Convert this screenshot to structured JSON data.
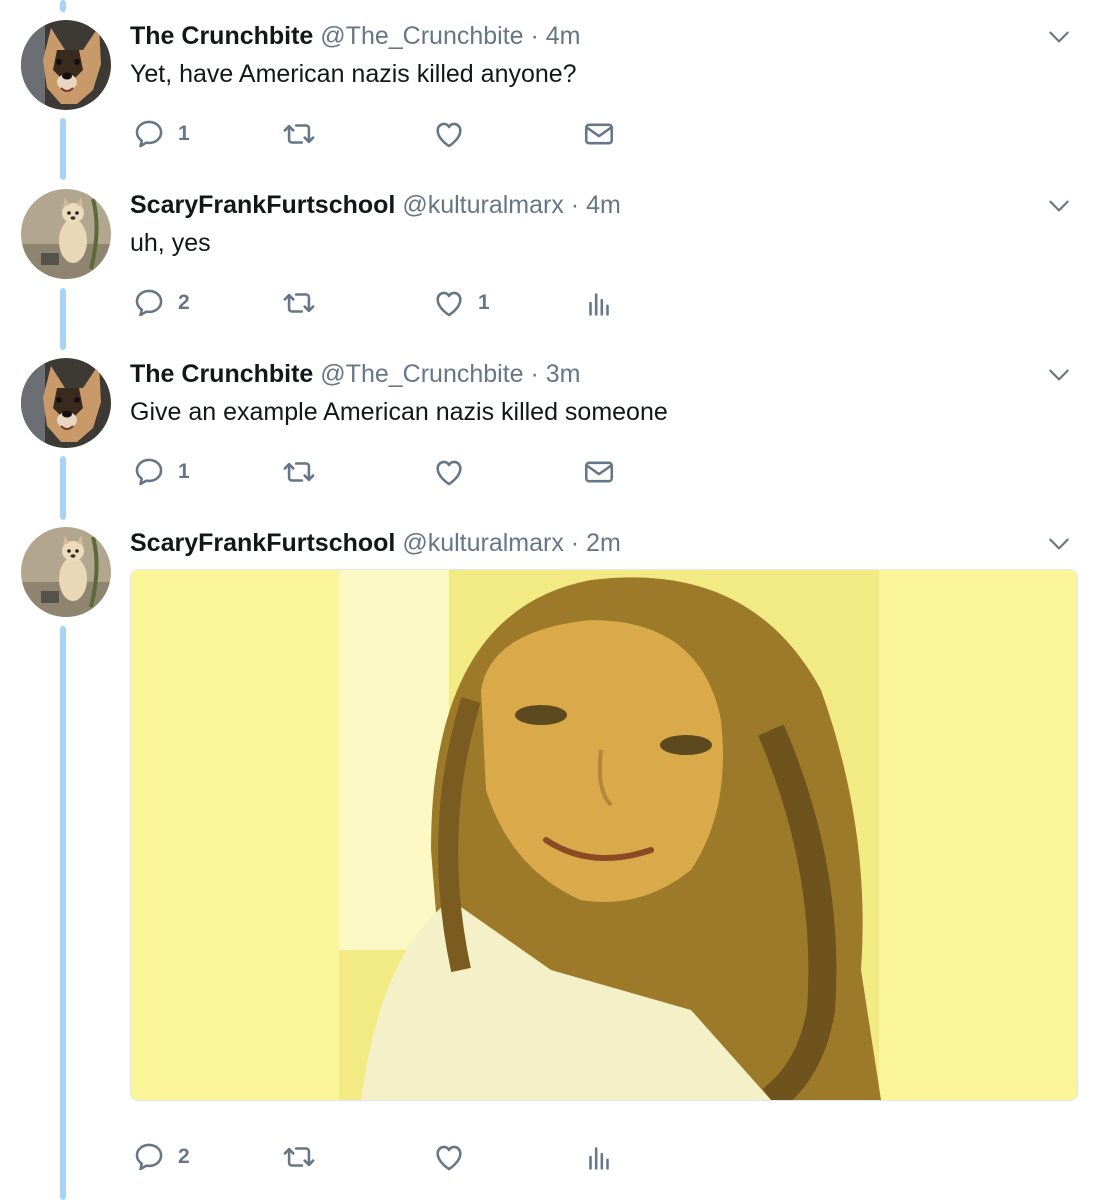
{
  "tweets": [
    {
      "name": "The Crunchbite",
      "handle": "@The_Crunchbite",
      "time": "4m",
      "text": "Yet, have American nazis killed anyone?",
      "avatar": "dog-avatar",
      "actions": {
        "reply": "1",
        "retweet": "",
        "like": "",
        "fourth": "mail-icon",
        "fourth_count": ""
      }
    },
    {
      "name": "ScaryFrankFurtschool",
      "handle": "@kulturalmarx",
      "time": "4m",
      "text": "uh, yes",
      "avatar": "puppy-avatar",
      "actions": {
        "reply": "2",
        "retweet": "",
        "like": "1",
        "fourth": "analytics-icon",
        "fourth_count": ""
      }
    },
    {
      "name": "The Crunchbite",
      "handle": "@The_Crunchbite",
      "time": "3m",
      "text": "Give an example American nazis killed someone",
      "avatar": "dog-avatar",
      "actions": {
        "reply": "1",
        "retweet": "",
        "like": "",
        "fourth": "mail-icon",
        "fourth_count": ""
      }
    },
    {
      "name": "ScaryFrankFurtschool",
      "handle": "@kulturalmarx",
      "time": "2m",
      "text": "",
      "avatar": "puppy-avatar",
      "media": "photo-of-woman-smiling",
      "actions": {
        "reply": "2",
        "retweet": "",
        "like": "",
        "fourth": "analytics-icon",
        "fourth_count": ""
      }
    }
  ],
  "colors": {
    "thread_line": "#a7d4f5",
    "text_primary": "#14171a",
    "text_secondary": "#657786",
    "media_background": "#fbf59a"
  },
  "separator": " · "
}
